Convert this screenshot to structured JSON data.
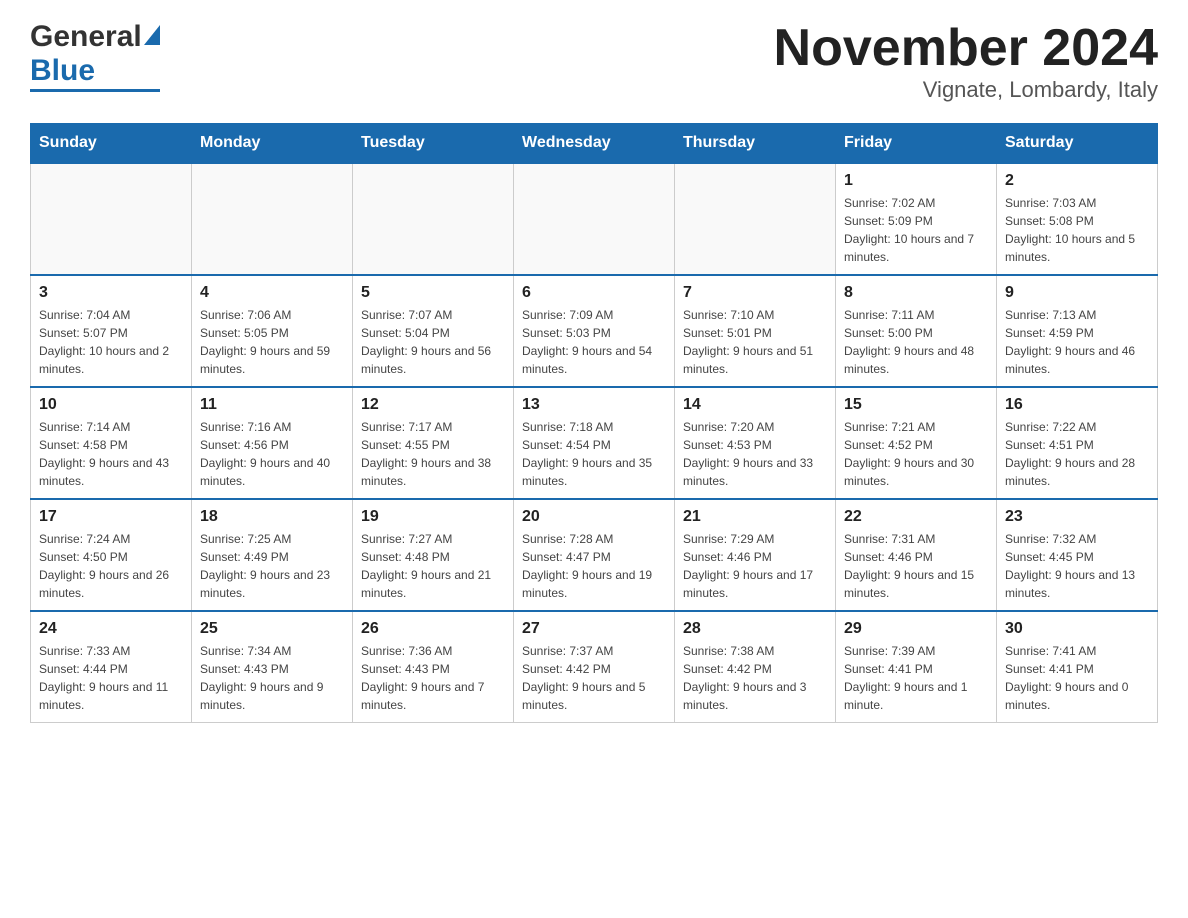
{
  "header": {
    "logo_general": "General",
    "logo_blue": "Blue",
    "title": "November 2024",
    "subtitle": "Vignate, Lombardy, Italy"
  },
  "days_of_week": [
    "Sunday",
    "Monday",
    "Tuesday",
    "Wednesday",
    "Thursday",
    "Friday",
    "Saturday"
  ],
  "weeks": [
    {
      "cells": [
        {
          "day": "",
          "info": ""
        },
        {
          "day": "",
          "info": ""
        },
        {
          "day": "",
          "info": ""
        },
        {
          "day": "",
          "info": ""
        },
        {
          "day": "",
          "info": ""
        },
        {
          "day": "1",
          "info": "Sunrise: 7:02 AM\nSunset: 5:09 PM\nDaylight: 10 hours and 7 minutes."
        },
        {
          "day": "2",
          "info": "Sunrise: 7:03 AM\nSunset: 5:08 PM\nDaylight: 10 hours and 5 minutes."
        }
      ]
    },
    {
      "cells": [
        {
          "day": "3",
          "info": "Sunrise: 7:04 AM\nSunset: 5:07 PM\nDaylight: 10 hours and 2 minutes."
        },
        {
          "day": "4",
          "info": "Sunrise: 7:06 AM\nSunset: 5:05 PM\nDaylight: 9 hours and 59 minutes."
        },
        {
          "day": "5",
          "info": "Sunrise: 7:07 AM\nSunset: 5:04 PM\nDaylight: 9 hours and 56 minutes."
        },
        {
          "day": "6",
          "info": "Sunrise: 7:09 AM\nSunset: 5:03 PM\nDaylight: 9 hours and 54 minutes."
        },
        {
          "day": "7",
          "info": "Sunrise: 7:10 AM\nSunset: 5:01 PM\nDaylight: 9 hours and 51 minutes."
        },
        {
          "day": "8",
          "info": "Sunrise: 7:11 AM\nSunset: 5:00 PM\nDaylight: 9 hours and 48 minutes."
        },
        {
          "day": "9",
          "info": "Sunrise: 7:13 AM\nSunset: 4:59 PM\nDaylight: 9 hours and 46 minutes."
        }
      ]
    },
    {
      "cells": [
        {
          "day": "10",
          "info": "Sunrise: 7:14 AM\nSunset: 4:58 PM\nDaylight: 9 hours and 43 minutes."
        },
        {
          "day": "11",
          "info": "Sunrise: 7:16 AM\nSunset: 4:56 PM\nDaylight: 9 hours and 40 minutes."
        },
        {
          "day": "12",
          "info": "Sunrise: 7:17 AM\nSunset: 4:55 PM\nDaylight: 9 hours and 38 minutes."
        },
        {
          "day": "13",
          "info": "Sunrise: 7:18 AM\nSunset: 4:54 PM\nDaylight: 9 hours and 35 minutes."
        },
        {
          "day": "14",
          "info": "Sunrise: 7:20 AM\nSunset: 4:53 PM\nDaylight: 9 hours and 33 minutes."
        },
        {
          "day": "15",
          "info": "Sunrise: 7:21 AM\nSunset: 4:52 PM\nDaylight: 9 hours and 30 minutes."
        },
        {
          "day": "16",
          "info": "Sunrise: 7:22 AM\nSunset: 4:51 PM\nDaylight: 9 hours and 28 minutes."
        }
      ]
    },
    {
      "cells": [
        {
          "day": "17",
          "info": "Sunrise: 7:24 AM\nSunset: 4:50 PM\nDaylight: 9 hours and 26 minutes."
        },
        {
          "day": "18",
          "info": "Sunrise: 7:25 AM\nSunset: 4:49 PM\nDaylight: 9 hours and 23 minutes."
        },
        {
          "day": "19",
          "info": "Sunrise: 7:27 AM\nSunset: 4:48 PM\nDaylight: 9 hours and 21 minutes."
        },
        {
          "day": "20",
          "info": "Sunrise: 7:28 AM\nSunset: 4:47 PM\nDaylight: 9 hours and 19 minutes."
        },
        {
          "day": "21",
          "info": "Sunrise: 7:29 AM\nSunset: 4:46 PM\nDaylight: 9 hours and 17 minutes."
        },
        {
          "day": "22",
          "info": "Sunrise: 7:31 AM\nSunset: 4:46 PM\nDaylight: 9 hours and 15 minutes."
        },
        {
          "day": "23",
          "info": "Sunrise: 7:32 AM\nSunset: 4:45 PM\nDaylight: 9 hours and 13 minutes."
        }
      ]
    },
    {
      "cells": [
        {
          "day": "24",
          "info": "Sunrise: 7:33 AM\nSunset: 4:44 PM\nDaylight: 9 hours and 11 minutes."
        },
        {
          "day": "25",
          "info": "Sunrise: 7:34 AM\nSunset: 4:43 PM\nDaylight: 9 hours and 9 minutes."
        },
        {
          "day": "26",
          "info": "Sunrise: 7:36 AM\nSunset: 4:43 PM\nDaylight: 9 hours and 7 minutes."
        },
        {
          "day": "27",
          "info": "Sunrise: 7:37 AM\nSunset: 4:42 PM\nDaylight: 9 hours and 5 minutes."
        },
        {
          "day": "28",
          "info": "Sunrise: 7:38 AM\nSunset: 4:42 PM\nDaylight: 9 hours and 3 minutes."
        },
        {
          "day": "29",
          "info": "Sunrise: 7:39 AM\nSunset: 4:41 PM\nDaylight: 9 hours and 1 minute."
        },
        {
          "day": "30",
          "info": "Sunrise: 7:41 AM\nSunset: 4:41 PM\nDaylight: 9 hours and 0 minutes."
        }
      ]
    }
  ]
}
